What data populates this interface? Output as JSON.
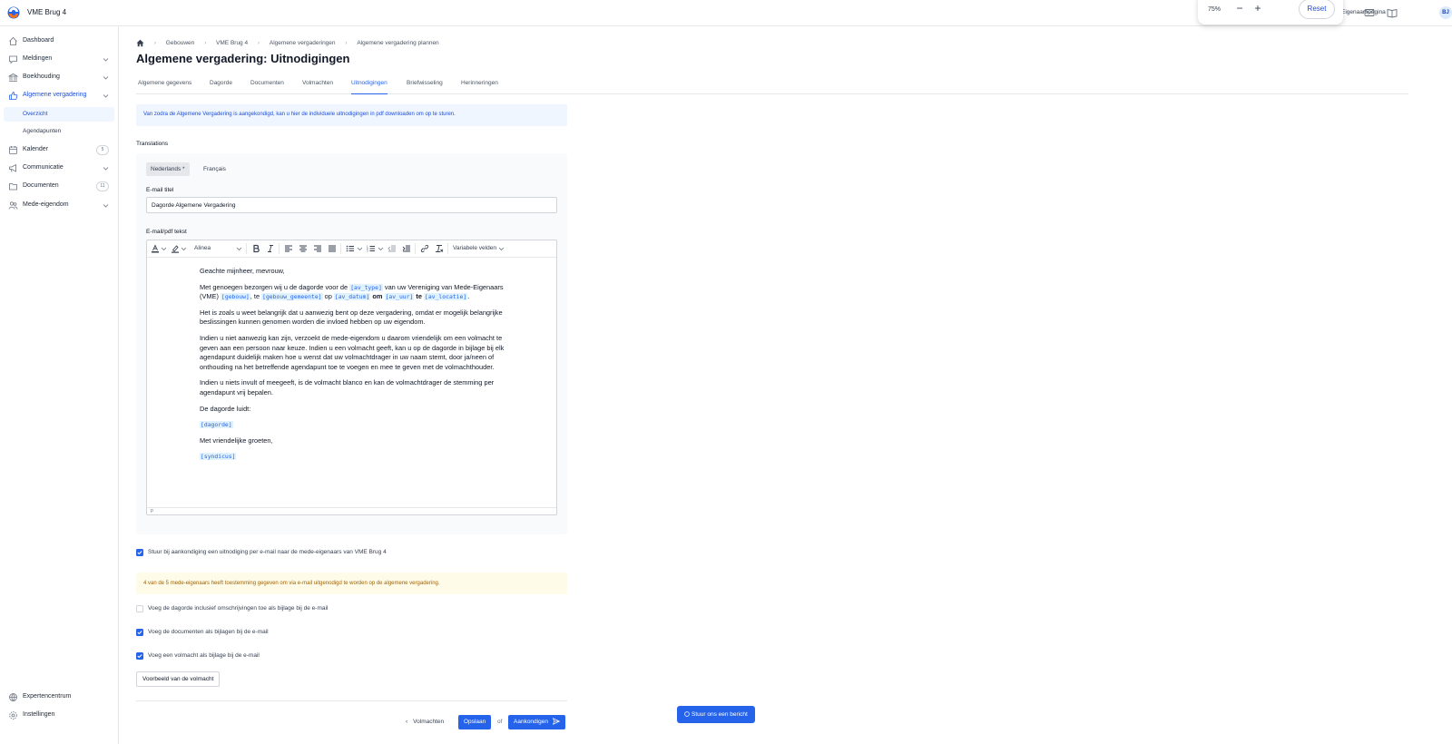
{
  "app": {
    "title": "VME Brug 4",
    "owner_link": "Eigenaarspagina",
    "avatar": "BJ"
  },
  "zoom": {
    "value": "75%",
    "minus": "−",
    "plus": "+",
    "reset": "Reset"
  },
  "sidebar": {
    "items": [
      {
        "label": "Dashboard"
      },
      {
        "label": "Meldingen"
      },
      {
        "label": "Boekhouding"
      },
      {
        "label": "Algemene vergadering"
      },
      {
        "label": "Kalender",
        "badge": "5"
      },
      {
        "label": "Communicatie"
      },
      {
        "label": "Documenten",
        "badge": "11"
      },
      {
        "label": "Mede-eigendom"
      }
    ],
    "subitems": [
      {
        "label": "Overzicht"
      },
      {
        "label": "Agendapunten"
      }
    ],
    "bottom": [
      {
        "label": "Expertencentrum"
      },
      {
        "label": "Instellingen"
      }
    ]
  },
  "breadcrumb": [
    "Gebouwen",
    "VME Brug 4",
    "Algemene vergaderingen",
    "Algemene vergadering plannen"
  ],
  "page_title": "Algemene vergadering: Uitnodigingen",
  "tabs": [
    "Algemene gegevens",
    "Dagorde",
    "Documenten",
    "Volmachten",
    "Uitnodigingen",
    "Briefwisseling",
    "Herinneringen"
  ],
  "info_text": "Van zodra de Algemene Vergadering is aangekondigd, kan u hier de individuele uitnodigingen in pdf downloaden om op te sturen.",
  "translations_label": "Translations",
  "lang_tabs": [
    "Nederlands *",
    "Français"
  ],
  "email_title_label": "E-mail titel",
  "email_title_value": "Dagorde Algemene Vergadering",
  "email_text_label": "E-mail/pdf tekst",
  "toolbar": {
    "paragraph": "Alinea",
    "variables": "Variabele velden"
  },
  "editor": {
    "p1": "Geachte mijnheer, mevrouw,",
    "p2a": "Met genoegen bezorgen wij u de dagorde voor de ",
    "p2b": " van uw Vereniging van Mede-Eigenaars (VME) ",
    "p2c": ", te ",
    "p2d": " op ",
    "p2e": "om",
    "p2f": "te",
    "v_type": "[av_type]",
    "v_gebouw": "[gebouw]",
    "v_gemeente": "[gebouw_gemeente]",
    "v_datum": "[av_datum]",
    "v_uur": "[av_uur]",
    "v_locatie": "[av_locatie]",
    "p3": "Het is zoals u weet belangrijk dat u aanwezig bent op deze vergadering, omdat er mogelijk belangrijke beslissingen kunnen genomen worden die invloed hebben op uw eigendom.",
    "p4": "Indien u niet aanwezig kan zijn, verzoekt de mede-eigendom u daarom vriendelijk om een volmacht te geven aan een persoon naar keuze. Indien u een volmacht geeft, kan u op de dagorde in bijlage bij elk agendapunt duidelijk maken hoe u wenst dat uw volmachtdrager in uw naam stemt, door ja/neen of onthouding na het betreffende agendapunt toe te voegen en mee te geven met de volmachthouder.",
    "p5": "Indien u  niets invult of meegeeft, is de volmacht blanco en kan de volmachtdrager de stemming per agendapunt vrij bepalen.",
    "p6": "De dagorde luidt:",
    "v_dagorde": "[dagorde]",
    "p7": "Met vriendelijke groeten,",
    "v_syndicus": "[syndicus]",
    "status": "p"
  },
  "checks": [
    {
      "label": "Stuur bij aankondiging een uitnodiging per e-mail naar de mede-eigenaars van VME Brug 4",
      "checked": true
    },
    {
      "label": "Voeg de dagorde inclusief omschrijvingen toe als bijlage bij de e-mail",
      "checked": false
    },
    {
      "label": "Voeg de documenten als bijlagen bij de e-mail",
      "checked": true
    },
    {
      "label": "Voeg een volmacht als bijlage bij de e-mail",
      "checked": true
    }
  ],
  "warn_text": "4 van de 5 mede-eigenaars heeft toestemming gegeven om via e-mail uitgenodigd te worden op de algemene vergadering.",
  "preview_button": "Voorbeeld van de volmacht",
  "footer": {
    "back": "Volmachten",
    "save": "Opslaan",
    "or": "of",
    "announce": "Aankondigen"
  },
  "chat_button": "Stuur ons een bericht",
  "colors": {
    "accent": "#2563eb",
    "info_bg": "#eff6ff",
    "warn_bg": "#fefce8"
  }
}
